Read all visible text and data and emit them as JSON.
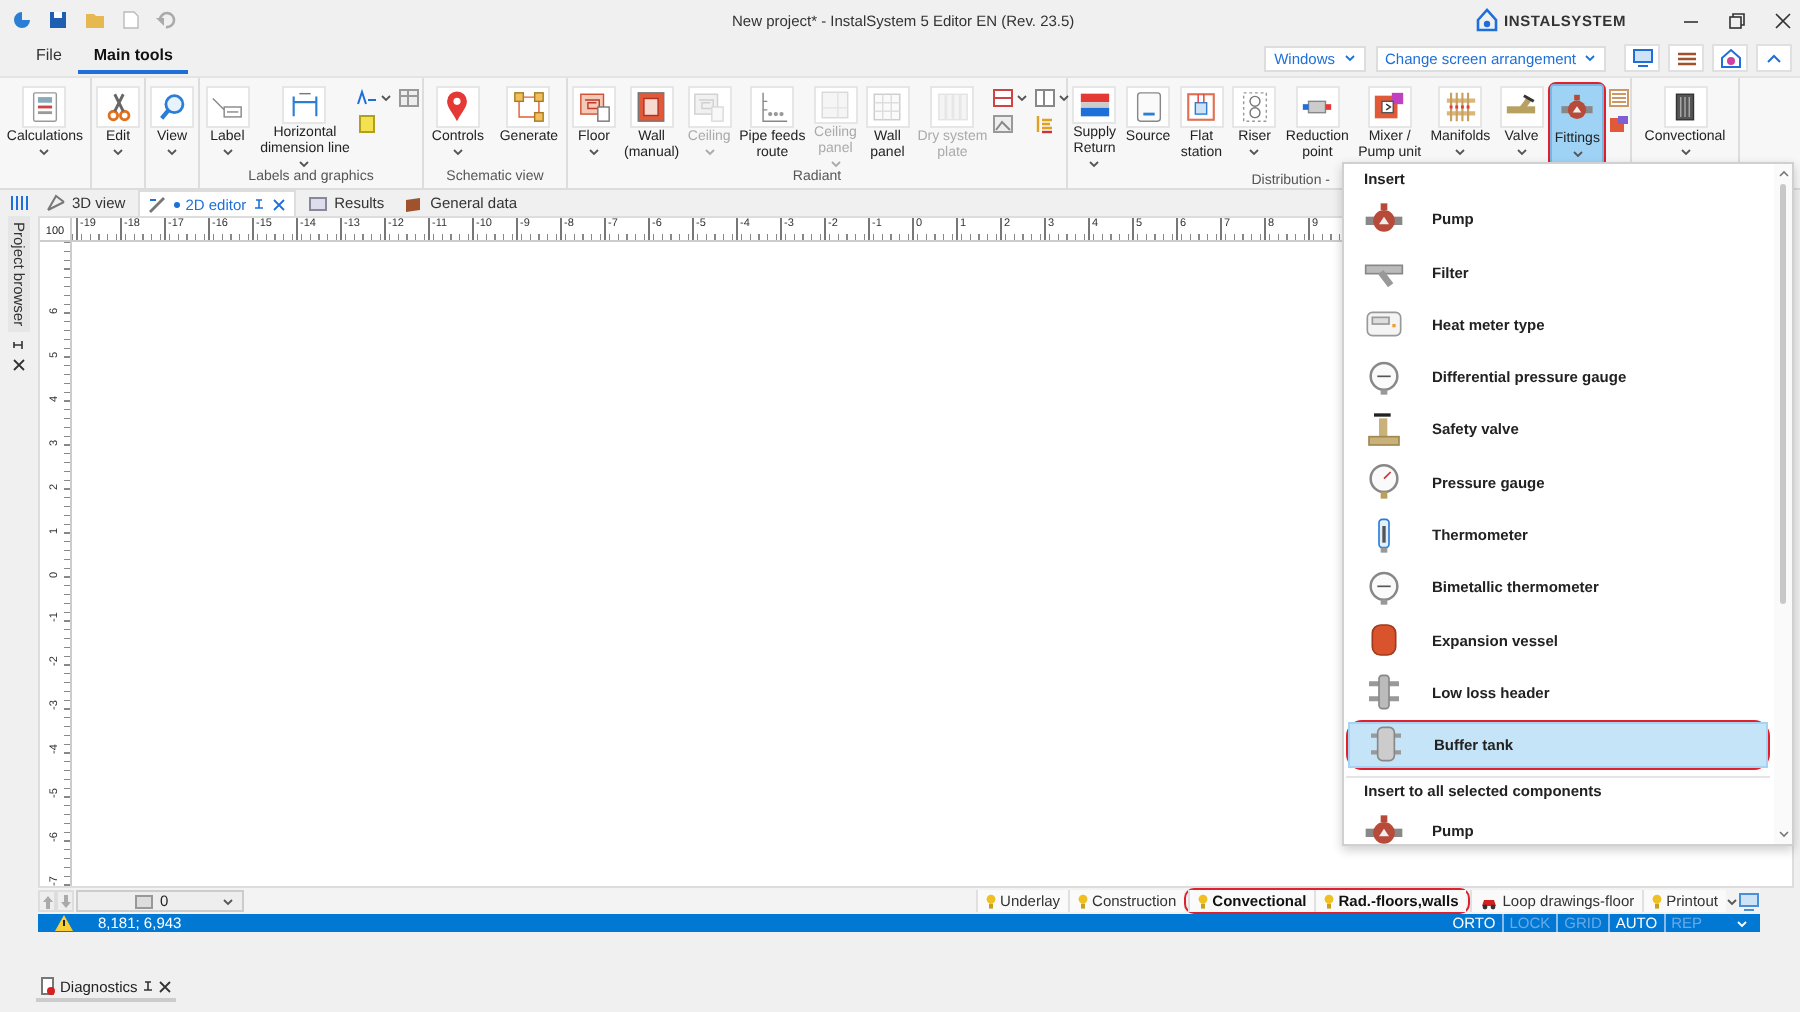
{
  "window": {
    "title": "New project* - InstalSystem 5 Editor EN (Rev. 23.5)",
    "logo": "INSTALSYSTEM"
  },
  "menu_tabs": [
    {
      "label": "File",
      "selected": false
    },
    {
      "label": "Main tools",
      "selected": true
    }
  ],
  "toolbar_dropdowns": [
    {
      "label": "Windows"
    },
    {
      "label": "Change screen arrangement"
    }
  ],
  "ribbon": {
    "groups": [
      {
        "buttons": [
          {
            "label": "Calculations",
            "dropdown": true,
            "disabled": false,
            "selected": false,
            "annotated": false
          }
        ]
      },
      {
        "buttons": [
          {
            "label": "Edit",
            "dropdown": true,
            "disabled": false,
            "selected": false,
            "annotated": false
          }
        ]
      },
      {
        "buttons": [
          {
            "label": "View",
            "dropdown": true,
            "disabled": false,
            "selected": false,
            "annotated": false
          }
        ]
      },
      {
        "label": "Labels and graphics",
        "buttons": [
          {
            "label": "Label",
            "dropdown": true,
            "disabled": false,
            "selected": false,
            "annotated": false
          },
          {
            "label": "Horizontal\ndimension line",
            "dropdown": true,
            "disabled": false,
            "selected": false,
            "annotated": false
          }
        ]
      },
      {
        "label": "Schematic view",
        "buttons": [
          {
            "label": "Controls",
            "dropdown": true,
            "disabled": false,
            "selected": false,
            "annotated": false
          },
          {
            "label": "Generate",
            "dropdown": false,
            "disabled": false,
            "selected": false,
            "annotated": false
          }
        ]
      },
      {
        "label": "Radiant",
        "buttons": [
          {
            "label": "Floor",
            "dropdown": true,
            "disabled": false,
            "selected": false,
            "annotated": false
          },
          {
            "label": "Wall\n(manual)",
            "dropdown": false,
            "disabled": false,
            "selected": false,
            "annotated": false
          },
          {
            "label": "Ceiling",
            "dropdown": true,
            "disabled": true,
            "selected": false,
            "annotated": false
          },
          {
            "label": "Pipe feeds\nroute",
            "dropdown": false,
            "disabled": false,
            "selected": false,
            "annotated": false
          },
          {
            "label": "Ceiling\npanel",
            "dropdown": true,
            "disabled": true,
            "selected": false,
            "annotated": false
          },
          {
            "label": "Wall\npanel",
            "dropdown": false,
            "disabled": false,
            "selected": false,
            "annotated": false
          },
          {
            "label": "Dry system\nplate",
            "dropdown": false,
            "disabled": true,
            "selected": false,
            "annotated": false
          }
        ]
      },
      {
        "label": "Distribution -",
        "buttons": [
          {
            "label": "Supply\nReturn",
            "dropdown": true,
            "disabled": false,
            "selected": false,
            "annotated": false
          },
          {
            "label": "Source",
            "dropdown": false,
            "disabled": false,
            "selected": false,
            "annotated": false
          },
          {
            "label": "Flat\nstation",
            "dropdown": false,
            "disabled": false,
            "selected": false,
            "annotated": false
          },
          {
            "label": "Riser",
            "dropdown": true,
            "disabled": false,
            "selected": false,
            "annotated": false
          },
          {
            "label": "Reduction\npoint",
            "dropdown": false,
            "disabled": false,
            "selected": false,
            "annotated": false
          },
          {
            "label": "Mixer /\nPump unit",
            "dropdown": false,
            "disabled": false,
            "selected": false,
            "annotated": false
          },
          {
            "label": "Manifolds",
            "dropdown": true,
            "disabled": false,
            "selected": false,
            "annotated": false
          },
          {
            "label": "Valve",
            "dropdown": true,
            "disabled": false,
            "selected": false,
            "annotated": false
          },
          {
            "label": "Fittings",
            "dropdown": true,
            "disabled": false,
            "selected": true,
            "annotated": true
          }
        ]
      },
      {
        "buttons": [
          {
            "label": "Convectional",
            "dropdown": true,
            "disabled": false,
            "selected": false,
            "annotated": false
          }
        ]
      }
    ]
  },
  "side_panel": {
    "label": "Project browser"
  },
  "doc_tabs": [
    {
      "label": "3D view",
      "selected": false,
      "modified": false
    },
    {
      "label": "2D editor",
      "selected": true,
      "modified": true
    },
    {
      "label": "Results",
      "selected": false,
      "modified": false
    },
    {
      "label": "General data",
      "selected": false,
      "modified": false
    }
  ],
  "ruler": {
    "scale": "100",
    "x_labels": [
      "-19",
      "-18",
      "-17",
      "-16",
      "-15",
      "-14",
      "-13",
      "-12",
      "-11",
      "-10",
      "-9",
      "-8",
      "-7",
      "-6",
      "-5",
      "-4",
      "-3",
      "-2",
      "-1",
      "0",
      "1",
      "2",
      "3",
      "4",
      "5",
      "6",
      "7",
      "8",
      "9"
    ],
    "y_labels": [
      "6",
      "5",
      "4",
      "3",
      "2",
      "1",
      "0",
      "-1",
      "-2",
      "-3",
      "-4",
      "-5",
      "-6",
      "-7"
    ]
  },
  "level_select": {
    "value": "0"
  },
  "layer_tabs": [
    {
      "label": "Underlay",
      "kind": "layer",
      "active": false,
      "annotated": false
    },
    {
      "label": "Construction",
      "kind": "layer",
      "active": false,
      "annotated": false
    },
    {
      "label": "Convectional",
      "kind": "layer",
      "active": true,
      "annotated": true
    },
    {
      "label": "Rad.-floors,walls",
      "kind": "layer",
      "active": true,
      "annotated": true
    },
    {
      "label": "Loop drawings-floor",
      "kind": "drawings",
      "active": false,
      "annotated": false
    },
    {
      "label": "Printout",
      "kind": "layer",
      "active": false,
      "annotated": false
    }
  ],
  "status_bar": {
    "coordinates": "8,181; 6,943",
    "warning": true,
    "modes": [
      {
        "label": "ORTO",
        "on": true
      },
      {
        "label": "LOCK",
        "on": false
      },
      {
        "label": "GRID",
        "on": false
      },
      {
        "label": "AUTO",
        "on": true
      },
      {
        "label": "REP",
        "on": false
      }
    ]
  },
  "bottom_panel": {
    "label": "Diagnostics"
  },
  "fittings_menu": {
    "sections": [
      {
        "header": "Insert",
        "items": [
          {
            "label": "Pump",
            "selected": false,
            "annotated": false
          },
          {
            "label": "Filter",
            "selected": false,
            "annotated": false
          },
          {
            "label": "Heat meter type",
            "selected": false,
            "annotated": false
          },
          {
            "label": "Differential pressure gauge",
            "selected": false,
            "annotated": false
          },
          {
            "label": "Safety valve",
            "selected": false,
            "annotated": false
          },
          {
            "label": "Pressure gauge",
            "selected": false,
            "annotated": false
          },
          {
            "label": "Thermometer",
            "selected": false,
            "annotated": false
          },
          {
            "label": "Bimetallic thermometer",
            "selected": false,
            "annotated": false
          },
          {
            "label": "Expansion vessel",
            "selected": false,
            "annotated": false
          },
          {
            "label": "Low loss header",
            "selected": false,
            "annotated": false
          },
          {
            "label": "Buffer tank",
            "selected": true,
            "annotated": true
          }
        ]
      },
      {
        "header": "Insert to all selected components",
        "items": [
          {
            "label": "Pump",
            "selected": false,
            "annotated": false
          }
        ]
      }
    ]
  }
}
